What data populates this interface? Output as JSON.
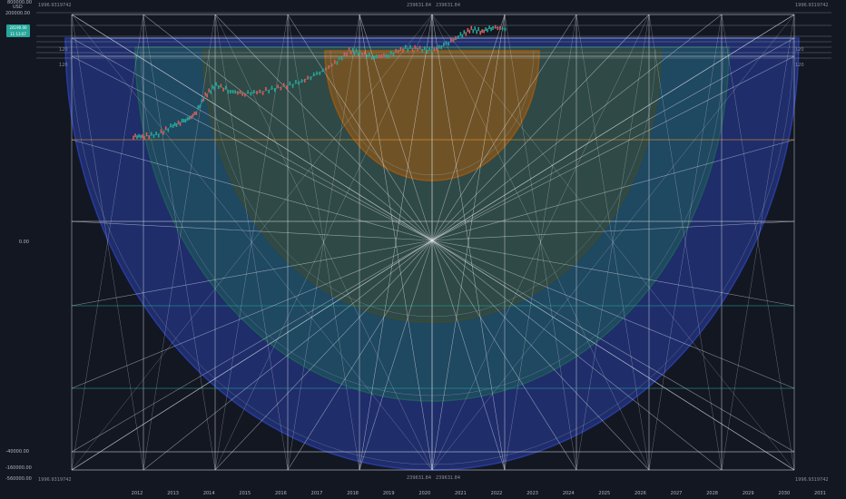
{
  "chart_data": {
    "type": "line",
    "title": "",
    "xlabel": "",
    "ylabel": "USD",
    "y_axis_top_value": "800000.00",
    "price_badge": [
      "24190.00",
      "11:13:07"
    ],
    "y_ticks": [
      "200000.00",
      "0.00",
      "-40000.00",
      "-160000.00",
      "-560000.00"
    ],
    "x_ticks": [
      "2012",
      "2013",
      "2014",
      "2015",
      "2016",
      "2017",
      "2018",
      "2019",
      "2020",
      "2021",
      "2022",
      "2023",
      "2024",
      "2025",
      "2026",
      "2027",
      "2028",
      "2029",
      "2030",
      "2031"
    ],
    "annotations": {
      "top_left": "1996.9319742",
      "top_right": "1996.9319742",
      "bottom_left": "1996.9319742",
      "bottom_right": "1996.9319742",
      "top_center_1": "239631.84",
      "top_center_2": "239631.84",
      "bottom_center_1": "239631.84",
      "bottom_center_2": "239631.84",
      "side_left_1": "120",
      "side_left_2": "120",
      "side_right_1": "120",
      "side_right_2": "120"
    },
    "series": [
      {
        "x": [
          2011.9,
          2012.2,
          2012.6,
          2013.0,
          2013.3,
          2013.6,
          2013.9,
          2014.2,
          2014.6,
          2015.0,
          2015.5,
          2016.0,
          2016.5,
          2017.0,
          2017.5,
          2017.9,
          2018.2,
          2018.6,
          2019.0,
          2019.4,
          2019.8,
          2020.2,
          2020.6,
          2021.0,
          2021.3,
          2021.6,
          2021.9,
          2022.3
        ],
        "values": [
          0.46,
          0.46,
          0.47,
          0.51,
          0.53,
          0.56,
          0.65,
          0.7,
          0.67,
          0.66,
          0.67,
          0.69,
          0.71,
          0.75,
          0.8,
          0.86,
          0.85,
          0.83,
          0.84,
          0.87,
          0.87,
          0.86,
          0.89,
          0.93,
          0.96,
          0.95,
          0.97,
          0.96
        ]
      }
    ],
    "shapes": [
      {
        "kind": "semicircle",
        "color": "#2a3fa8"
      },
      {
        "kind": "semicircle",
        "color": "#1f5f5a"
      },
      {
        "kind": "semicircle",
        "color": "#3f4a2c"
      },
      {
        "kind": "semicircle",
        "color": "#9b5a12"
      }
    ]
  }
}
